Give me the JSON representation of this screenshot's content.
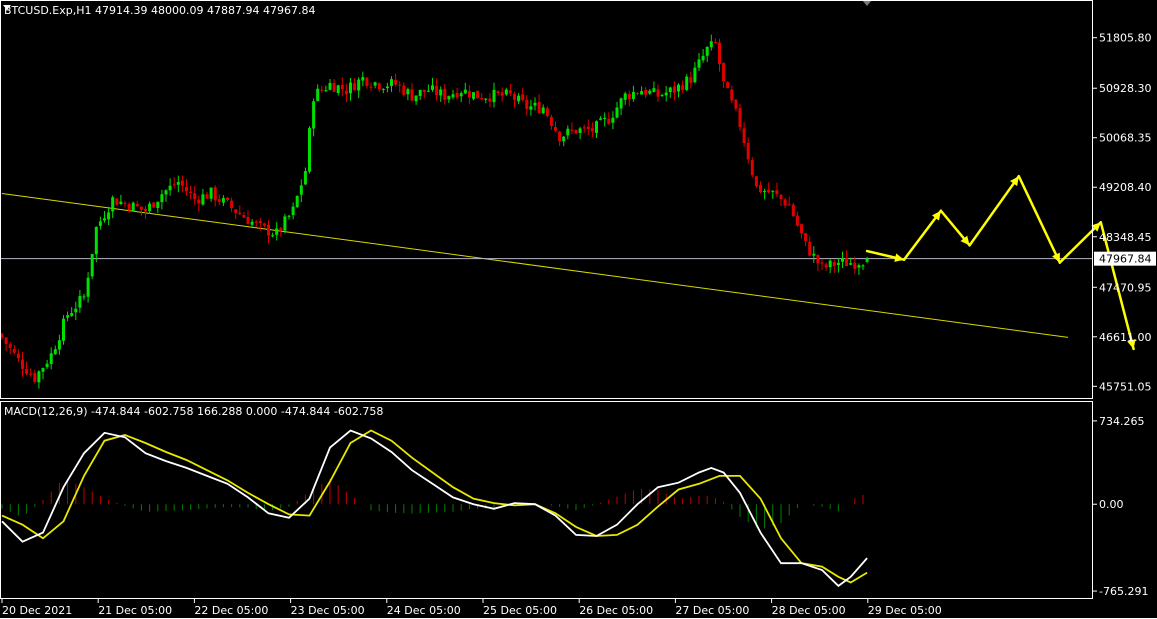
{
  "colors": {
    "background": "#000000",
    "frame": "#ffffff",
    "bull": "#00e000",
    "bear": "#e00000",
    "trendline": "#d8d800",
    "forecast": "#ffff00",
    "macd_line": "#ffffff",
    "signal_line": "#e8e800",
    "hist_pos": "#c00000",
    "hist_neg": "#008000",
    "price_line": "#b4b4c8"
  },
  "chart_data": [
    {
      "type": "candlestick",
      "symbol_header": "BTCUSD.Exp,H1  47914.39 48000.09 47887.94 47967.84",
      "ohlc_last": [
        47914.39,
        48000.09,
        47887.94,
        47967.84
      ],
      "current_price": "47967.84",
      "y_ticks": [
        "51805.80",
        "50928.30",
        "50068.35",
        "49208.40",
        "48348.45",
        "47470.95",
        "46611.00",
        "45751.05"
      ],
      "ylim": [
        45600,
        52200
      ],
      "x_ticks": [
        "20 Dec 2021",
        "21 Dec 05:00",
        "22 Dec 05:00",
        "23 Dec 05:00",
        "24 Dec 05:00",
        "25 Dec 05:00",
        "26 Dec 05:00",
        "27 Dec 05:00",
        "28 Dec 05:00",
        "29 Dec 05:00"
      ],
      "close_anchors": [
        [
          0,
          46600
        ],
        [
          4,
          46200
        ],
        [
          8,
          45900
        ],
        [
          12,
          46300
        ],
        [
          16,
          47000
        ],
        [
          20,
          47300
        ],
        [
          23,
          48500
        ],
        [
          27,
          49000
        ],
        [
          31,
          48900
        ],
        [
          35,
          48800
        ],
        [
          39,
          49100
        ],
        [
          43,
          49300
        ],
        [
          47,
          49000
        ],
        [
          51,
          49100
        ],
        [
          55,
          48900
        ],
        [
          59,
          48700
        ],
        [
          63,
          48500
        ],
        [
          67,
          48400
        ],
        [
          71,
          48800
        ],
        [
          74,
          49500
        ],
        [
          76,
          50800
        ],
        [
          80,
          51000
        ],
        [
          84,
          50900
        ],
        [
          88,
          51100
        ],
        [
          92,
          51000
        ],
        [
          96,
          51000
        ],
        [
          100,
          50800
        ],
        [
          104,
          50900
        ],
        [
          108,
          50800
        ],
        [
          112,
          50900
        ],
        [
          116,
          50800
        ],
        [
          120,
          50800
        ],
        [
          124,
          50800
        ],
        [
          128,
          50600
        ],
        [
          132,
          50600
        ],
        [
          136,
          50100
        ],
        [
          140,
          50200
        ],
        [
          144,
          50200
        ],
        [
          148,
          50400
        ],
        [
          152,
          50800
        ],
        [
          156,
          50900
        ],
        [
          160,
          50800
        ],
        [
          164,
          50900
        ],
        [
          168,
          51100
        ],
        [
          172,
          51600
        ],
        [
          174,
          51700
        ],
        [
          176,
          51000
        ],
        [
          180,
          50300
        ],
        [
          184,
          49200
        ],
        [
          188,
          49100
        ],
        [
          192,
          48900
        ],
        [
          196,
          48200
        ],
        [
          200,
          47800
        ],
        [
          204,
          47900
        ],
        [
          208,
          47900
        ],
        [
          211,
          47968
        ]
      ],
      "trendline": [
        [
          0,
          49100
        ],
        [
          260,
          46600
        ]
      ],
      "forecast_path": [
        [
          211,
          48100
        ],
        [
          220,
          47950
        ],
        [
          229,
          48800
        ],
        [
          236,
          48200
        ],
        [
          248,
          49400
        ],
        [
          258,
          47900
        ],
        [
          268,
          48600
        ],
        [
          276,
          46400
        ]
      ]
    },
    {
      "type": "line",
      "title": "MACD(12,26,9) -474.844 -602.758 166.288 0.000 -474.844 -602.758",
      "y_ticks": [
        "734.265",
        "0.00",
        "-765.291"
      ],
      "ylim": [
        -800,
        760
      ],
      "series": [
        {
          "name": "MACD",
          "values": [
            [
              0,
              -150
            ],
            [
              5,
              -330
            ],
            [
              10,
              -250
            ],
            [
              15,
              150
            ],
            [
              20,
              450
            ],
            [
              25,
              630
            ],
            [
              30,
              590
            ],
            [
              35,
              450
            ],
            [
              40,
              380
            ],
            [
              45,
              320
            ],
            [
              50,
              250
            ],
            [
              55,
              180
            ],
            [
              60,
              60
            ],
            [
              65,
              -80
            ],
            [
              70,
              -120
            ],
            [
              75,
              50
            ],
            [
              80,
              500
            ],
            [
              85,
              650
            ],
            [
              90,
              580
            ],
            [
              95,
              460
            ],
            [
              100,
              300
            ],
            [
              105,
              180
            ],
            [
              110,
              60
            ],
            [
              115,
              0
            ],
            [
              120,
              -40
            ],
            [
              125,
              10
            ],
            [
              130,
              0
            ],
            [
              135,
              -100
            ],
            [
              140,
              -270
            ],
            [
              145,
              -280
            ],
            [
              150,
              -180
            ],
            [
              155,
              0
            ],
            [
              160,
              150
            ],
            [
              165,
              190
            ],
            [
              170,
              280
            ],
            [
              173,
              320
            ],
            [
              176,
              280
            ],
            [
              180,
              100
            ],
            [
              185,
              -250
            ],
            [
              190,
              -520
            ],
            [
              195,
              -520
            ],
            [
              200,
              -580
            ],
            [
              204,
              -720
            ],
            [
              207,
              -640
            ],
            [
              211,
              -475
            ]
          ]
        },
        {
          "name": "Signal",
          "values": [
            [
              0,
              -100
            ],
            [
              5,
              -180
            ],
            [
              10,
              -300
            ],
            [
              15,
              -150
            ],
            [
              20,
              250
            ],
            [
              25,
              560
            ],
            [
              30,
              610
            ],
            [
              35,
              540
            ],
            [
              40,
              460
            ],
            [
              45,
              390
            ],
            [
              50,
              300
            ],
            [
              55,
              210
            ],
            [
              60,
              100
            ],
            [
              65,
              0
            ],
            [
              70,
              -90
            ],
            [
              75,
              -100
            ],
            [
              80,
              200
            ],
            [
              85,
              540
            ],
            [
              90,
              650
            ],
            [
              95,
              560
            ],
            [
              100,
              410
            ],
            [
              105,
              280
            ],
            [
              110,
              150
            ],
            [
              115,
              50
            ],
            [
              120,
              10
            ],
            [
              125,
              -10
            ],
            [
              130,
              0
            ],
            [
              135,
              -80
            ],
            [
              140,
              -200
            ],
            [
              145,
              -280
            ],
            [
              150,
              -270
            ],
            [
              155,
              -180
            ],
            [
              160,
              -20
            ],
            [
              165,
              130
            ],
            [
              170,
              180
            ],
            [
              175,
              250
            ],
            [
              180,
              250
            ],
            [
              185,
              50
            ],
            [
              190,
              -300
            ],
            [
              195,
              -520
            ],
            [
              200,
              -550
            ],
            [
              204,
              -640
            ],
            [
              207,
              -690
            ],
            [
              211,
              -603
            ]
          ]
        }
      ]
    }
  ]
}
